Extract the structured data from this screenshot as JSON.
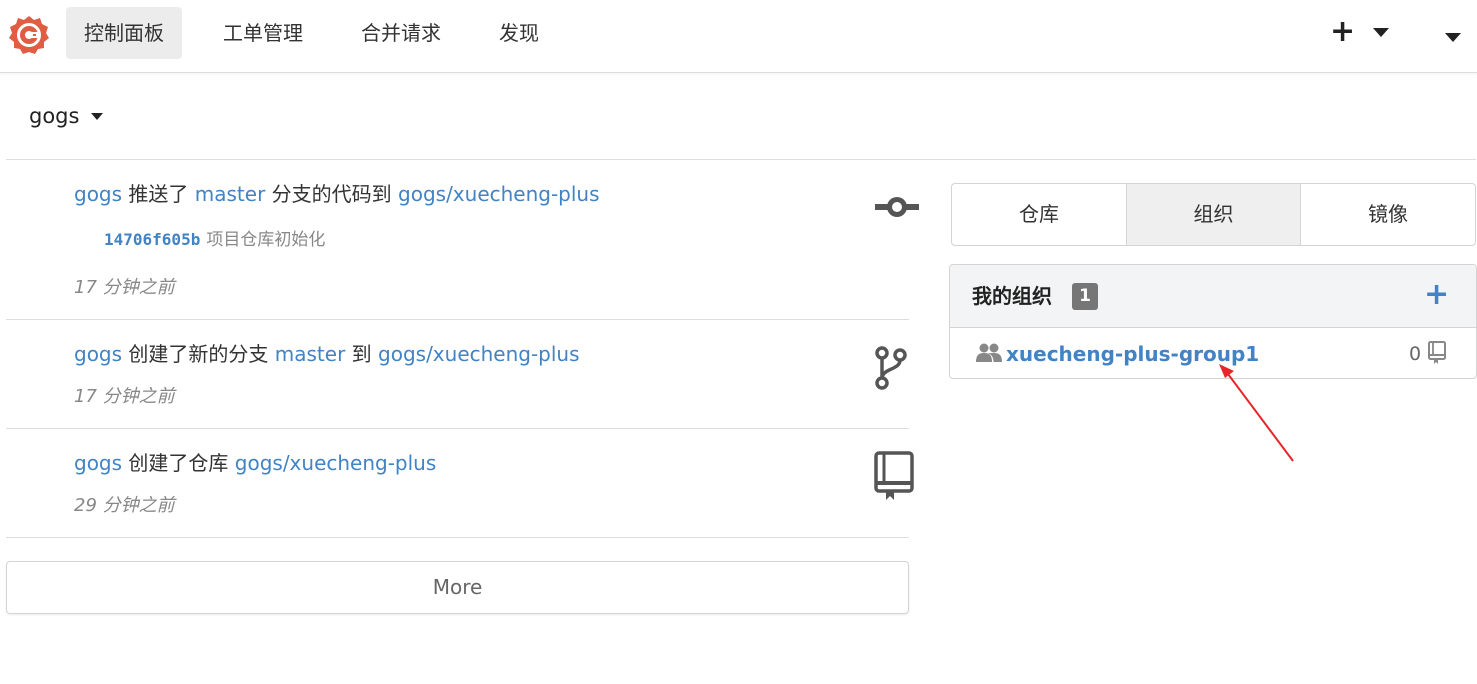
{
  "navbar": {
    "logo_icon": "gogs-logo-icon",
    "items": [
      {
        "label": "控制面板",
        "active": true
      },
      {
        "label": "工单管理",
        "active": false
      },
      {
        "label": "合并请求",
        "active": false
      },
      {
        "label": "发现",
        "active": false
      }
    ],
    "plus_label": "+",
    "brand_color": "#e05d44"
  },
  "context": {
    "name": "gogs"
  },
  "feed": [
    {
      "user": "gogs",
      "action": "推送了",
      "branch": "master",
      "middle": "分支的代码到",
      "repo": "gogs/xuecheng-plus",
      "commit_sha": "14706f605b",
      "commit_msg": "项目仓库初始化",
      "time": "17 分钟之前",
      "icon": "commit-icon"
    },
    {
      "user": "gogs",
      "action": "创建了新的分支",
      "branch": "master",
      "middle": "到",
      "repo": "gogs/xuecheng-plus",
      "time": "17 分钟之前",
      "icon": "branch-icon"
    },
    {
      "user": "gogs",
      "action": "创建了仓库",
      "repo": "gogs/xuecheng-plus",
      "time": "29 分钟之前",
      "icon": "repo-icon"
    }
  ],
  "more_label": "More",
  "tabs": [
    {
      "label": "仓库",
      "active": false
    },
    {
      "label": "组织",
      "active": true
    },
    {
      "label": "镜像",
      "active": false
    }
  ],
  "orgs": {
    "title": "我的组织",
    "count": "1",
    "add_label": "+",
    "items": [
      {
        "name": "xuecheng-plus-group1",
        "repo_count": "0"
      }
    ]
  },
  "colors": {
    "link": "#4183c4",
    "annotation": "#e8262a"
  }
}
